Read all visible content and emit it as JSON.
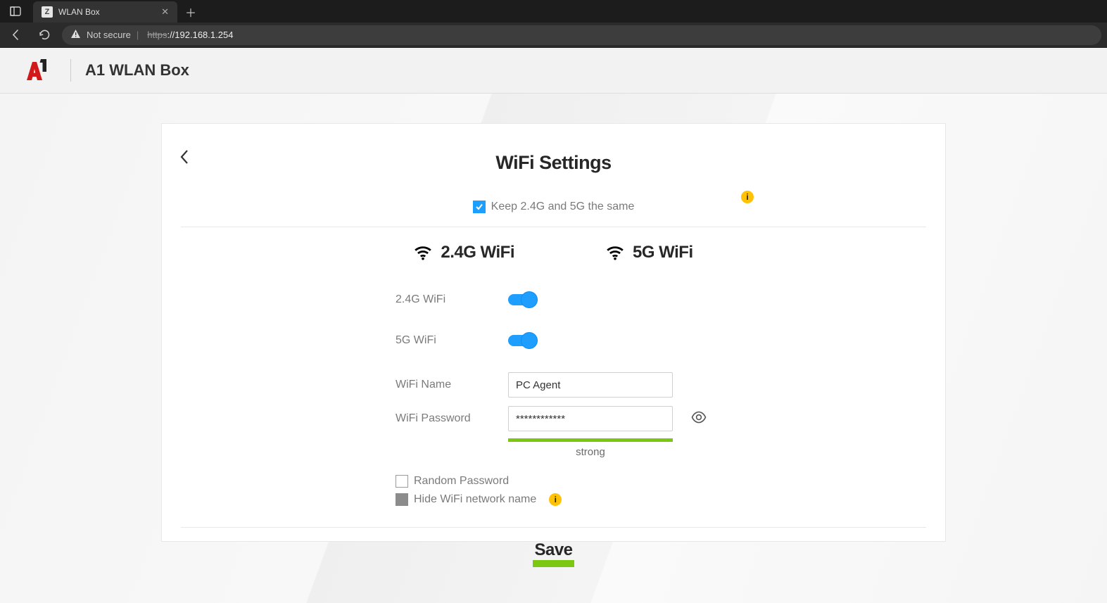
{
  "browser": {
    "tab": {
      "favicon": "Z",
      "title": "WLAN Box"
    },
    "url": {
      "warn": "Not secure",
      "protocol": "https",
      "rest": "://192.168.1.254"
    }
  },
  "header": {
    "title": "A1 WLAN Box"
  },
  "page": {
    "title": "WiFi Settings",
    "keep_same_label": "Keep 2.4G and 5G the same",
    "band24": "2.4G WiFi",
    "band5": "5G WiFi",
    "labels": {
      "wifi_24": "2.4G WiFi",
      "wifi_5": "5G WiFi",
      "name": "WiFi Name",
      "password": "WiFi Password"
    },
    "values": {
      "name": "PC Agent",
      "password_masked": "************",
      "strength": "strong"
    },
    "options": {
      "random": "Random Password",
      "hide": "Hide WiFi network name"
    },
    "save": "Save",
    "info_glyph": "i",
    "colors": {
      "accent": "#1e9eff",
      "strength": "#7cc712",
      "info": "#ffc207"
    }
  }
}
